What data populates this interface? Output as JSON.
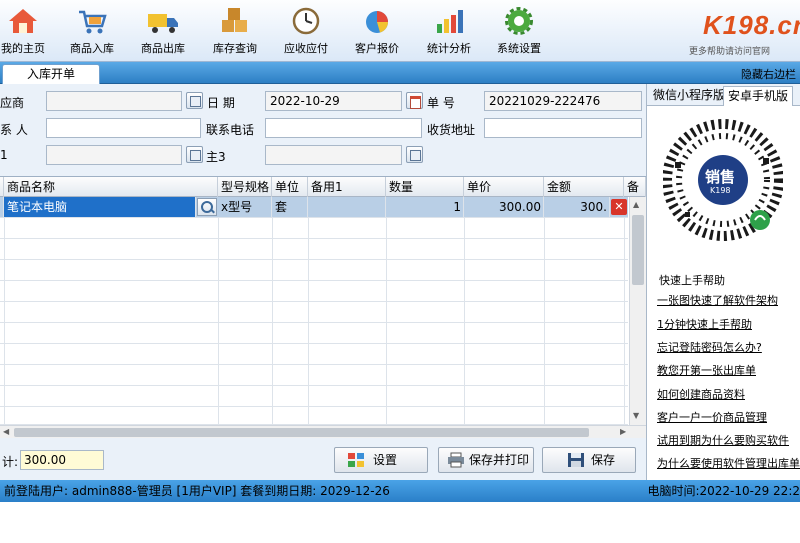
{
  "toolbar": {
    "items": [
      {
        "label": "我的主页",
        "icon": "home-icon"
      },
      {
        "label": "商品入库",
        "icon": "cart-icon"
      },
      {
        "label": "商品出库",
        "icon": "truck-icon"
      },
      {
        "label": "库存查询",
        "icon": "boxes-icon"
      },
      {
        "label": "应收应付",
        "icon": "clock-icon"
      },
      {
        "label": "客户报价",
        "icon": "chart-pie-icon"
      },
      {
        "label": "统计分析",
        "icon": "bar-chart-icon"
      },
      {
        "label": "系统设置",
        "icon": "gear-icon"
      }
    ],
    "logo_text": "K198.cn",
    "logo_sub": "更多帮助请访问官网"
  },
  "tabbar": {
    "tab": "入库开单",
    "hide_right": "隐藏右边栏"
  },
  "form": {
    "supplier_label": "应商",
    "date_label": "日   期",
    "date_value": "2022-10-29",
    "order_no_label": "单   号",
    "order_no_value": "20221029-222476",
    "contact_label": "系 人",
    "phone_label": "联系电话",
    "address_label": "收货地址",
    "row3_label": "1",
    "remark3_label": "主3"
  },
  "grid": {
    "headers": [
      "商品名称",
      "型号规格",
      "单位",
      "备用1",
      "数量",
      "单价",
      "金额",
      "备"
    ],
    "rows": [
      {
        "name": "笔记本电脑",
        "model": "x型号",
        "unit": "套",
        "spare": "",
        "qty": "1",
        "price": "300.00",
        "amount": "300."
      }
    ]
  },
  "bottom": {
    "total_label": "计:",
    "total_value": "300.00",
    "settings_label": "设置",
    "save_print_label": "保存并打印",
    "save_label": "保存"
  },
  "right_panel": {
    "tabs": [
      "微信小程序版",
      "安卓手机版"
    ],
    "qr_badge": "销售",
    "qr_sub": "K198",
    "help_title": "快速上手帮助",
    "links": [
      "一张图快速了解软件架构",
      "1分钟快速上手帮助",
      "忘记登陆密码怎么办?",
      "教您开第一张出库单",
      "如何创建商品资料",
      "客户一户一价商品管理",
      "试用到期为什么要购买软件",
      "为什么要使用软件管理出库单"
    ]
  },
  "status": {
    "left": "前登陆用户: admin888-管理员  [1用户VIP]  套餐到期日期: 2029-12-26",
    "right": "电脑时间:2022-10-29 22:2"
  },
  "colors": {
    "accent_blue": "#2d7fc4",
    "selected_cell": "#1f70c9",
    "logo_orange": "#e0521c",
    "delete_red": "#d8352a"
  }
}
